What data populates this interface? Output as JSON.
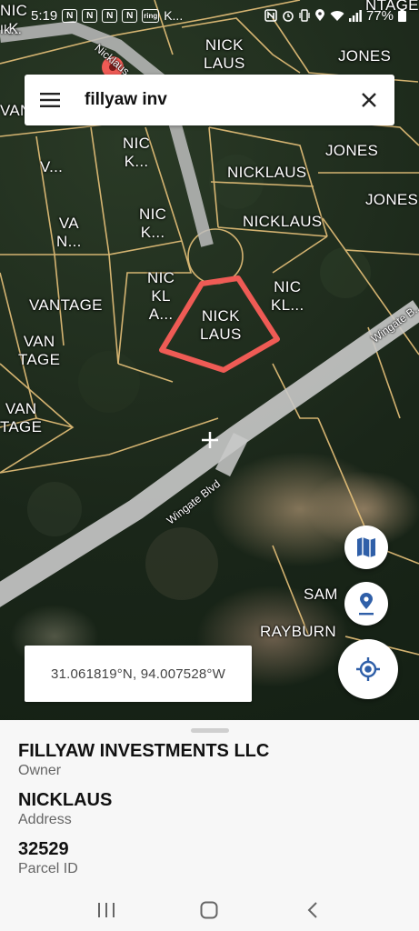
{
  "status_bar": {
    "time": "5:19",
    "notification_chips": [
      "N",
      "N",
      "N",
      "N",
      "ring"
    ],
    "notification_text": "K...",
    "battery": "77%"
  },
  "search": {
    "value": "fillyaw inv",
    "menu_icon": "hamburger-menu-icon",
    "clear_icon": "close-icon"
  },
  "map": {
    "lot_labels": [
      "NIC\nK",
      "NICK\nLAUS",
      "JONES",
      "VAN",
      "V...",
      "NIC\nK...",
      "NICKLAUS",
      "JONES",
      "JONES",
      "VA\nN...",
      "NIC\nK...",
      "NICKLAUS",
      "VANTAGE",
      "NIC\nKL\nA...",
      "NICK\nLAUS",
      "NIC\nKL...",
      "VAN\nTAGE",
      "VAN\nTAGE",
      "SAM",
      "RAYBURN",
      "NTAGE",
      "Ik..."
    ],
    "road_labels": [
      "Nicklaus...",
      "Wingate Blvd",
      "Wingate B..."
    ],
    "highlight_color": "#ef5b55",
    "parcel_line_color": "#e8c27a"
  },
  "coordinates": "31.061819°N, 94.007528°W",
  "fabs": {
    "map_layers": "map-layers-icon",
    "dropped_pin": "location-pin-icon",
    "my_location": "my-location-icon"
  },
  "parcel": {
    "owner_value": "FILLYAW INVESTMENTS LLC",
    "owner_label": "Owner",
    "address_value": "NICKLAUS",
    "address_label": "Address",
    "parcel_id_value": "32529",
    "parcel_id_label": "Parcel ID"
  },
  "nav": {
    "recents": "recents-icon",
    "home": "home-icon",
    "back": "back-icon"
  },
  "colors": {
    "accent_blue": "#2f5fa8",
    "sheet_bg": "#f7f7f7"
  }
}
